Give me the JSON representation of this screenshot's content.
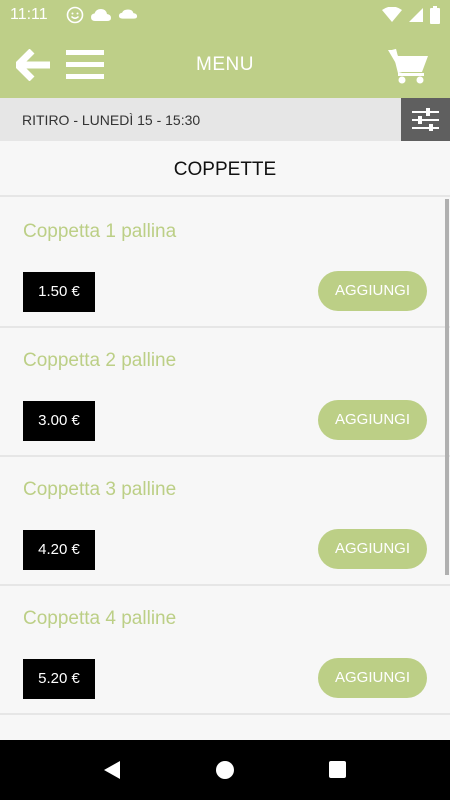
{
  "status_bar": {
    "time": "11:11",
    "left_icons": [
      "smiley-icon",
      "cloud-icon",
      "cloud-icon"
    ],
    "right_icons": [
      "wifi-icon",
      "signal-icon",
      "battery-icon"
    ]
  },
  "app_bar": {
    "title": "MENU",
    "icons": [
      "back-arrow-icon",
      "hamburger-menu-icon",
      "cart-icon"
    ]
  },
  "pickup": {
    "label": "RITIRO - LUNEDÌ 15 - 15:30",
    "filter_icon": "sliders-icon"
  },
  "category": {
    "title": "COPPETTE"
  },
  "products": [
    {
      "name": "Coppetta 1 pallina",
      "price": "1.50 €",
      "add_label": "AGGIUNGI"
    },
    {
      "name": "Coppetta 2 palline",
      "price": "3.00 €",
      "add_label": "AGGIUNGI"
    },
    {
      "name": "Coppetta 3 palline",
      "price": "4.20 €",
      "add_label": "AGGIUNGI"
    },
    {
      "name": "Coppetta 4 palline",
      "price": "5.20 €",
      "add_label": "AGGIUNGI"
    }
  ],
  "colors": {
    "accent": "#becf88",
    "price_bg": "#000000",
    "filter_bg": "#5f5f5f"
  }
}
